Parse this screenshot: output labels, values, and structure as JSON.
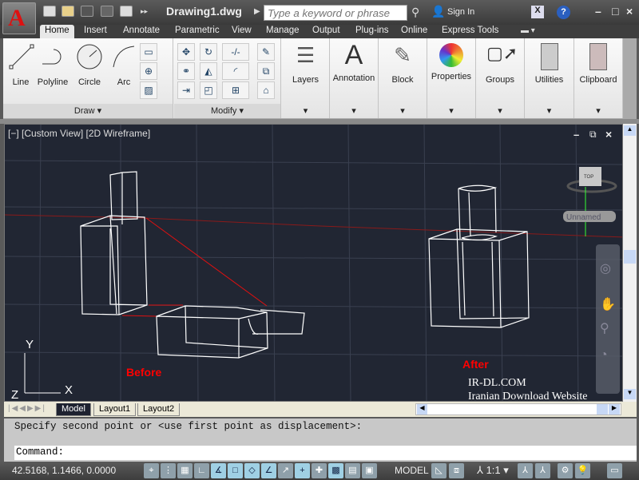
{
  "app": {
    "title": "Drawing1.dwg",
    "logo": "A"
  },
  "search": {
    "placeholder": "Type a keyword or phrase"
  },
  "header": {
    "sign_in": "Sign In",
    "help": "?",
    "exchange": "X"
  },
  "window_controls": {
    "minimize": "–",
    "maximize": "□",
    "close": "×"
  },
  "tabs": [
    "Home",
    "Insert",
    "Annotate",
    "Parametric",
    "View",
    "Manage",
    "Output",
    "Plug-ins",
    "Online",
    "Express Tools"
  ],
  "active_tab": "Home",
  "ribbon": {
    "draw": {
      "label": "Draw",
      "tools": [
        "Line",
        "Polyline",
        "Circle",
        "Arc"
      ]
    },
    "modify": {
      "label": "Modify"
    },
    "panels": [
      "Layers",
      "Annotation",
      "Block",
      "Properties",
      "Groups",
      "Utilities",
      "Clipboard"
    ]
  },
  "viewport": {
    "label": "[−] [Custom View] [2D Wireframe]",
    "before": "Before",
    "after": "After",
    "viewcube": "TOP",
    "ucs_label": "Unnamed",
    "axis_x": "X",
    "axis_y": "Y",
    "axis_z": "Z",
    "watermark_1": "IR-DL.COM",
    "watermark_2": "Iranian Download Website"
  },
  "layout_tabs": [
    "Model",
    "Layout1",
    "Layout2"
  ],
  "command": {
    "history": "Specify second point or <use first point as displacement>:",
    "prompt": "Command:"
  },
  "status": {
    "coords": "42.5168, 1.1466, 0.0000",
    "model": "MODEL",
    "scale": "1:1"
  },
  "colors": {
    "background": "#212633",
    "annotation_red": "#ff0000",
    "wireframe": "#ffffff"
  }
}
